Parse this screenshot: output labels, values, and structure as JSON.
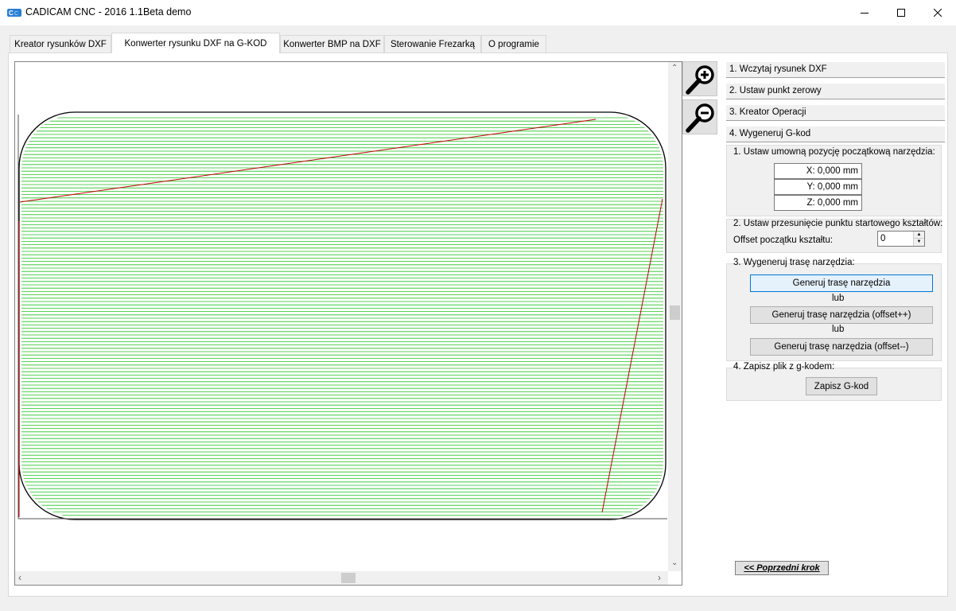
{
  "window": {
    "title": "CADICAM CNC - 2016 1.1Beta demo",
    "app_icon": "cadicam-logo-icon",
    "controls": {
      "minimize": "minimize-icon",
      "maximize": "maximize-icon",
      "close": "close-icon"
    }
  },
  "tabs": [
    {
      "label": "Kreator rysunków DXF",
      "active": false
    },
    {
      "label": "Konwerter rysunku DXF na G-KOD",
      "active": true
    },
    {
      "label": "Konwerter BMP na DXF",
      "active": false
    },
    {
      "label": "Sterowanie Frezarką",
      "active": false
    },
    {
      "label": "O programie",
      "active": false
    }
  ],
  "toolbar": {
    "zoom_in_icon": "zoom-in-icon",
    "zoom_out_icon": "zoom-out-icon"
  },
  "steps": [
    "1. Wczytaj rysunek DXF",
    "2. Ustaw punkt zerowy",
    "3. Kreator Operacji",
    "4. Wygeneruj G-kod"
  ],
  "section1": {
    "title": "1. Ustaw umowną pozycję początkową narzędzia:",
    "x": "X: 0,000 mm",
    "y": "Y: 0,000 mm",
    "z": "Z: 0,000 mm"
  },
  "section2": {
    "title": "2. Ustaw przesunięcie punktu startowego kształtów:",
    "offset_label": "Offset początku kształtu:",
    "offset_value": "0"
  },
  "section3": {
    "title": "3. Wygeneruj trasę narzędzia:",
    "btn_generate": "Generuj trasę narzędzia",
    "or1": "lub",
    "btn_offset_plus": "Generuj trasę narzędzia (offset++)",
    "or2": "lub",
    "btn_offset_minus": "Generuj trasę narzędzia (offset--)"
  },
  "section4": {
    "title": "4. Zapisz plik z g-kodem:",
    "btn_save": "Zapisz G-kod"
  },
  "prev_step": "<< Poprzedni krok",
  "colors": {
    "toolpath": "#22c322",
    "rapid": "#d00000",
    "outline": "#000000",
    "accent": "#0078d7"
  }
}
